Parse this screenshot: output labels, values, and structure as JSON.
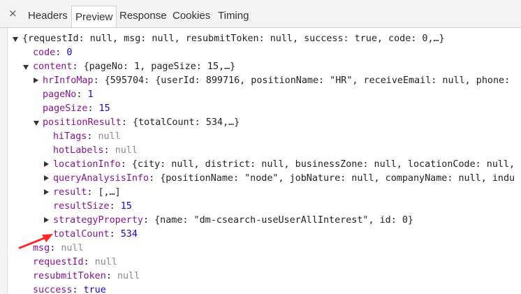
{
  "tabs": [
    {
      "label": "Headers"
    },
    {
      "label": "Preview"
    },
    {
      "label": "Response"
    },
    {
      "label": "Cookies"
    },
    {
      "label": "Timing"
    }
  ],
  "close_glyph": "×",
  "root": {
    "preview": "{requestId: null, msg: null, resubmitToken: null, success: true, code: 0,…}"
  },
  "code": {
    "key": "code",
    "value": "0"
  },
  "content": {
    "key": "content",
    "preview": "{pageNo: 1, pageSize: 15,…}"
  },
  "hrInfoMap": {
    "key": "hrInfoMap",
    "preview": "{595704: {userId: 899716, positionName: \"HR\", receiveEmail: null, phone:"
  },
  "pageNo": {
    "key": "pageNo",
    "value": "1"
  },
  "pageSize": {
    "key": "pageSize",
    "value": "15"
  },
  "positionResult": {
    "key": "positionResult",
    "preview": "{totalCount: 534,…}"
  },
  "hiTags": {
    "key": "hiTags",
    "value": "null"
  },
  "hotLabels": {
    "key": "hotLabels",
    "value": "null"
  },
  "locationInfo": {
    "key": "locationInfo",
    "preview": "{city: null, district: null, businessZone: null, locationCode: null,"
  },
  "queryAnalysisInfo": {
    "key": "queryAnalysisInfo",
    "preview": "{positionName: \"node\", jobNature: null, companyName: null, indu"
  },
  "result": {
    "key": "result",
    "preview": "[,…]"
  },
  "resultSize": {
    "key": "resultSize",
    "value": "15"
  },
  "strategyProperty": {
    "key": "strategyProperty",
    "preview": "{name: \"dm-csearch-useUserAllInterest\", id: 0}"
  },
  "totalCount": {
    "key": "totalCount",
    "value": "534"
  },
  "msg": {
    "key": "msg",
    "value": "null"
  },
  "requestId": {
    "key": "requestId",
    "value": "null"
  },
  "resubmitToken": {
    "key": "resubmitToken",
    "value": "null"
  },
  "success": {
    "key": "success",
    "value": "true"
  },
  "colors": {
    "key": "#881391",
    "number": "#1c00cf",
    "null": "#8a8a8a",
    "arrow": "#ff2a2a"
  }
}
